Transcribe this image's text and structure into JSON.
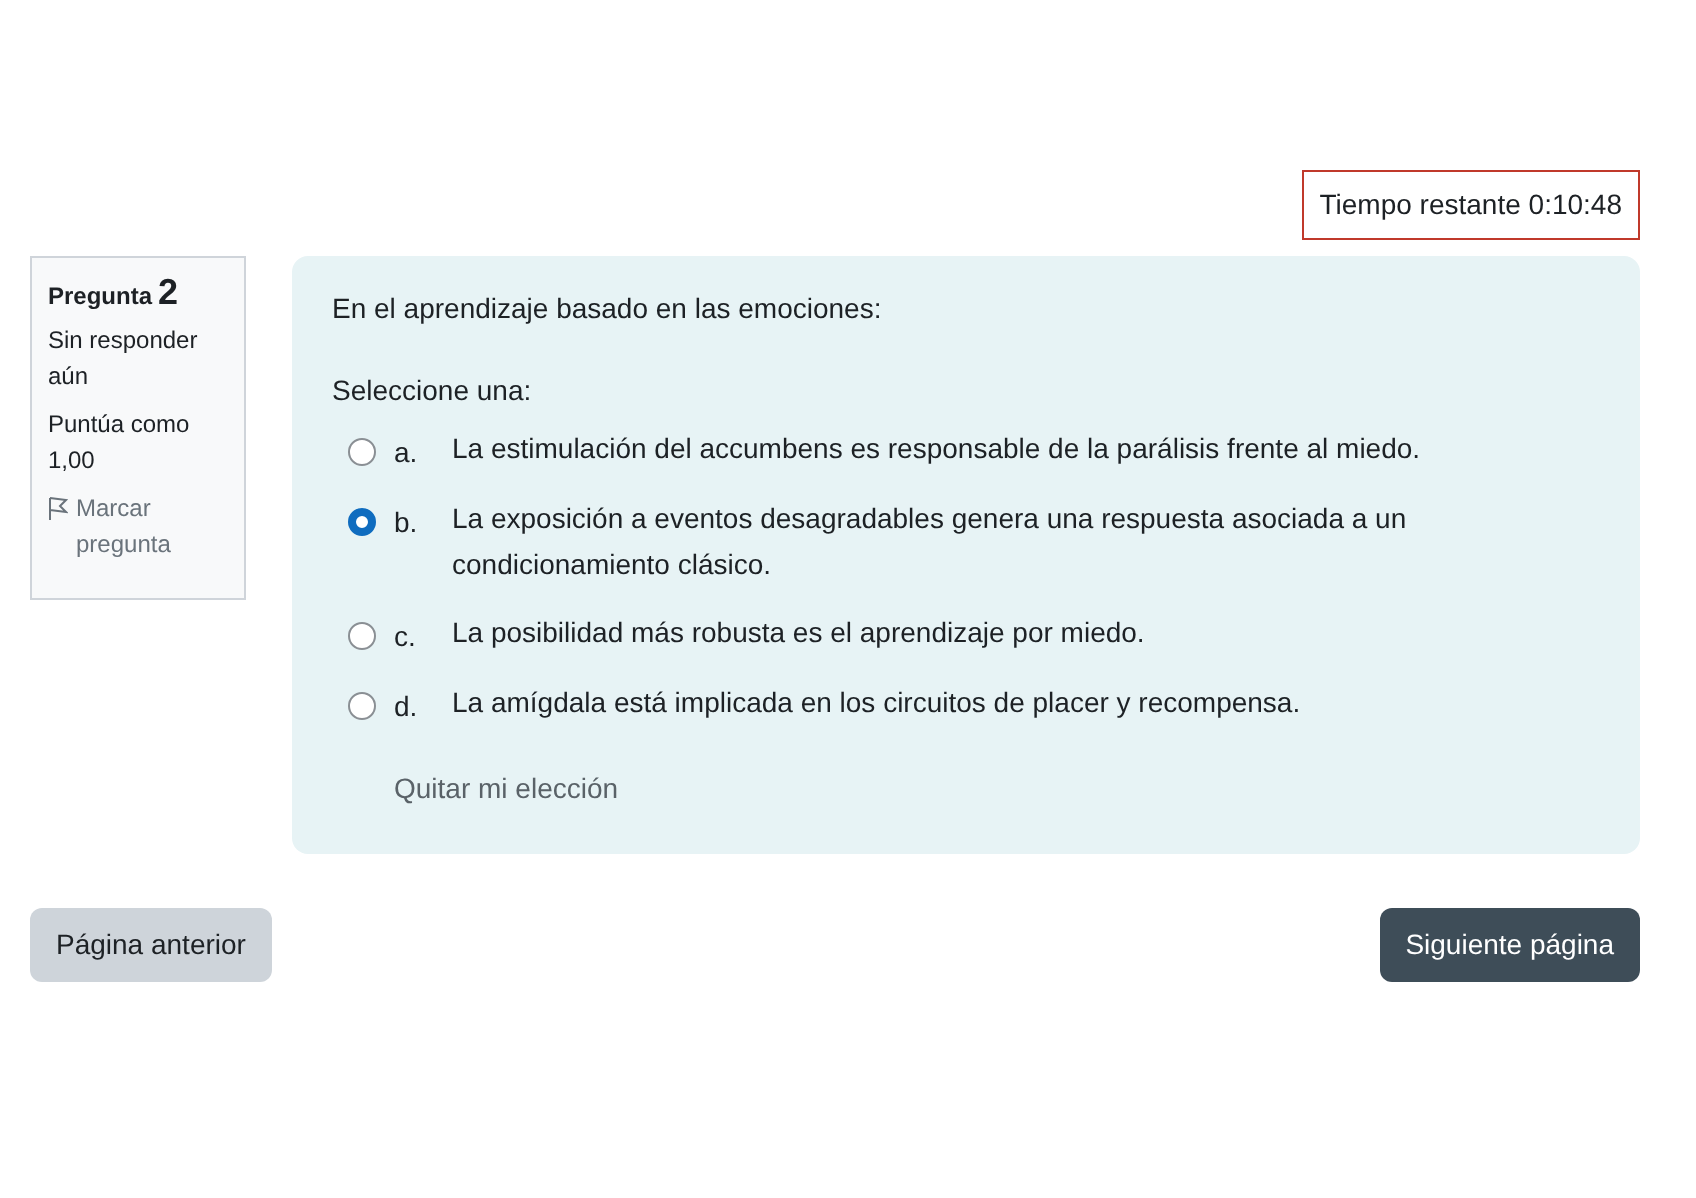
{
  "timer": {
    "label": "Tiempo restante",
    "value": "0:10:48"
  },
  "info": {
    "label": "Pregunta",
    "number": "2",
    "state": "Sin responder aún",
    "grade": "Puntúa como",
    "grade_value": "1,00",
    "flag": "Marcar pregunta",
    "flagged": false
  },
  "question": {
    "text": "En el aprendizaje basado en las emociones:",
    "prompt": "Seleccione una:",
    "options": [
      {
        "letter": "a.",
        "text": "La estimulación del accumbens es responsable de la parálisis frente al miedo.",
        "selected": false
      },
      {
        "letter": "b.",
        "text": "La exposición a eventos desagradables genera una respuesta asociada a un condicionamiento clásico.",
        "selected": true
      },
      {
        "letter": "c.",
        "text": "La posibilidad más robusta es el aprendizaje por miedo.",
        "selected": false
      },
      {
        "letter": "d.",
        "text": "La amígdala está implicada en los circuitos de placer y recompensa.",
        "selected": false
      }
    ],
    "clear": "Quitar mi elección"
  },
  "buttons": {
    "previous": "Página anterior",
    "next": "Siguiente página"
  }
}
